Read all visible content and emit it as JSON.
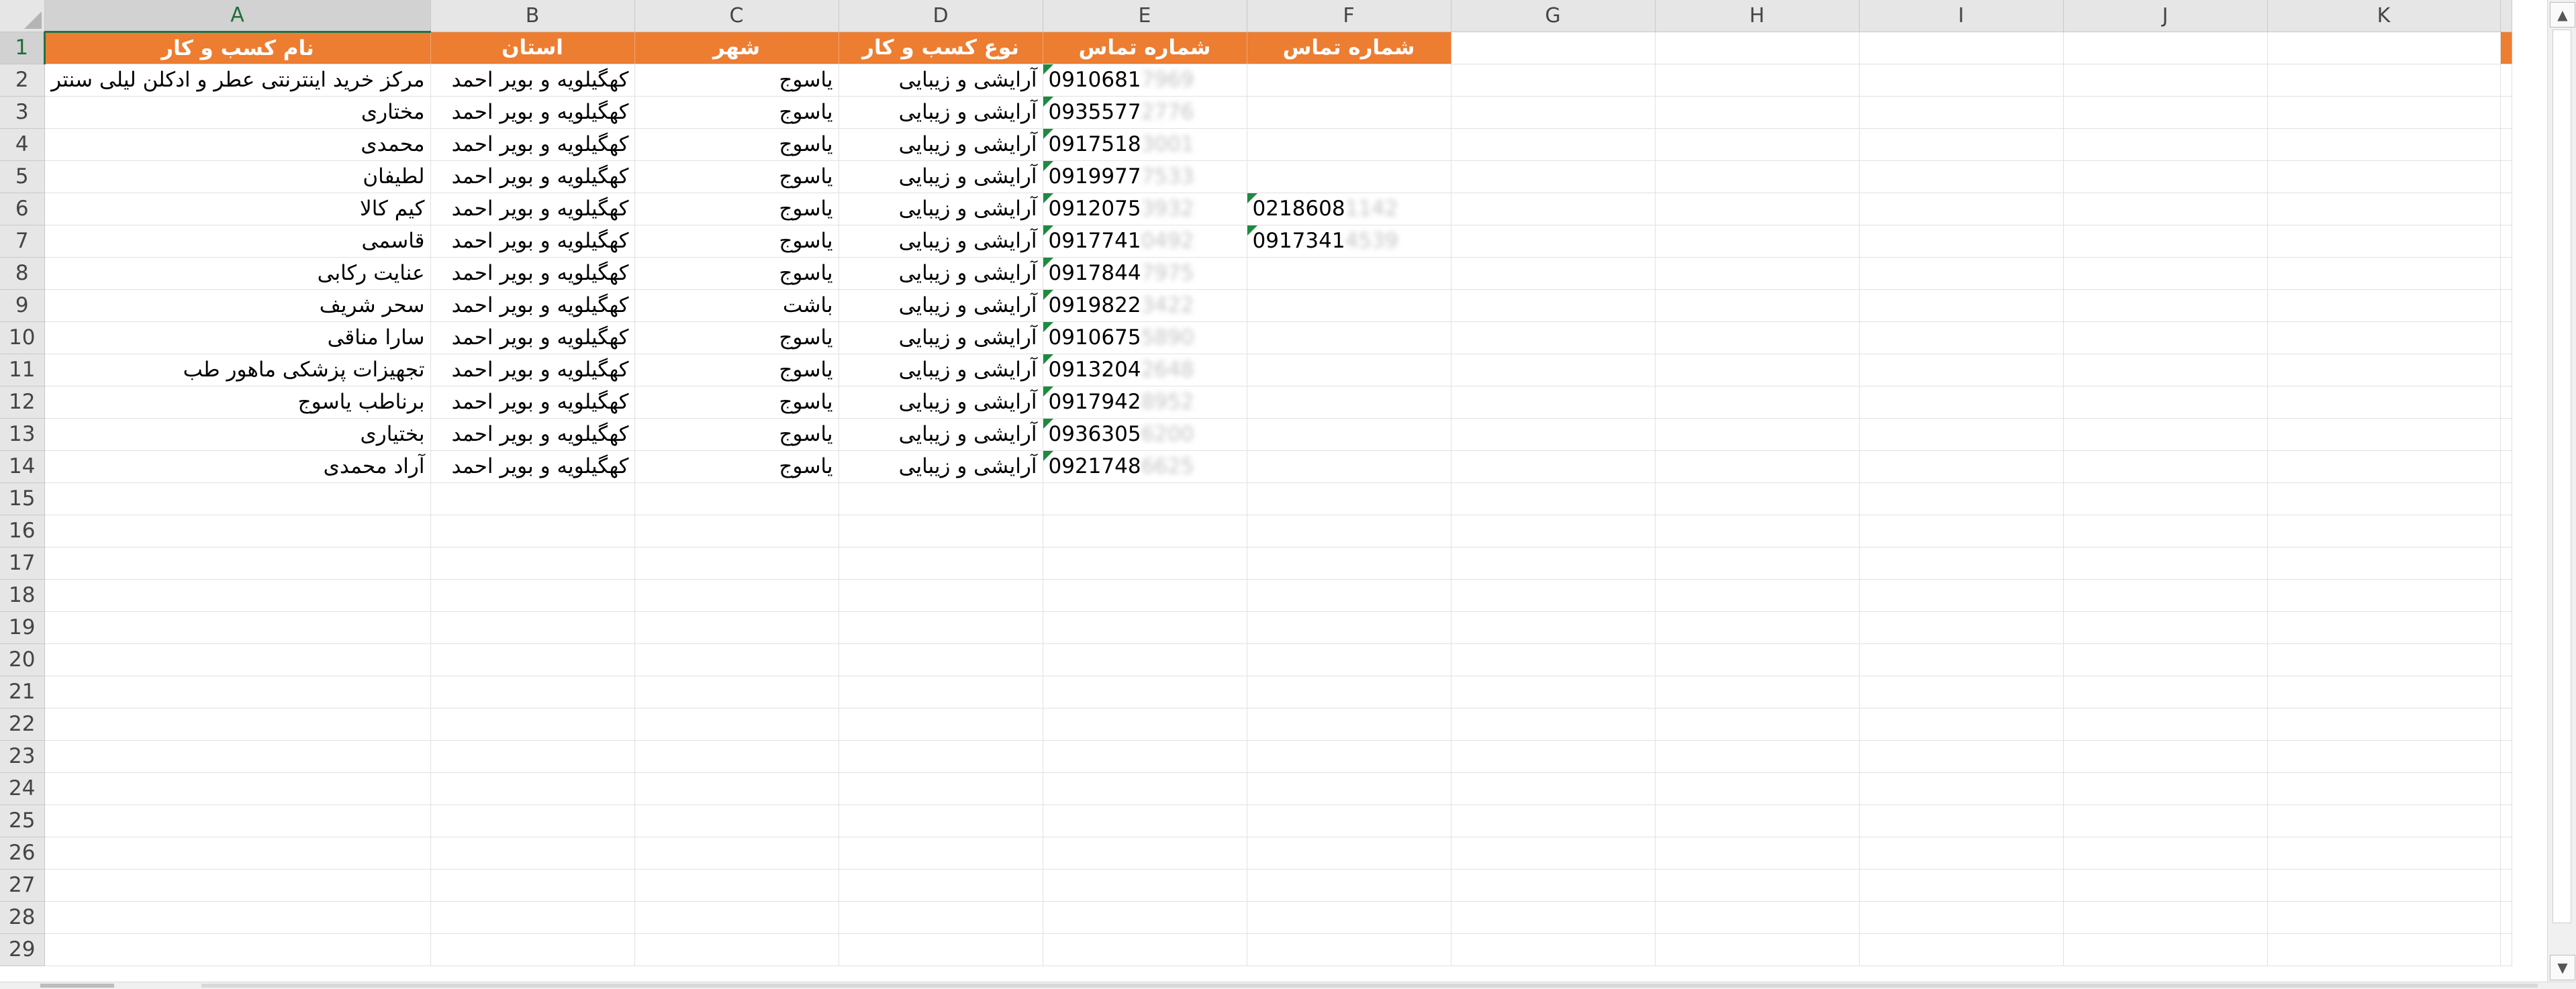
{
  "columns": [
    "A",
    "B",
    "C",
    "D",
    "E",
    "F",
    "G",
    "H",
    "I",
    "J",
    "K"
  ],
  "header_row": [
    "نام کسب و کار",
    "استان",
    "شهر",
    "نوع کسب و کار",
    "شماره تماس",
    "شماره تماس"
  ],
  "rows": [
    {
      "name": "مرکز خرید اینترنتی عطر و ادکلن لیلی سنتر",
      "province": "کهگیلویه و بویر احمد",
      "city": "یاسوج",
      "type": "آرایشی و زیبایی",
      "phone": "0910681",
      "phone_hidden": "7969",
      "phone2": "",
      "phone2_hidden": ""
    },
    {
      "name": "مختاری",
      "province": "کهگیلویه و بویر احمد",
      "city": "یاسوج",
      "type": "آرایشی و زیبایی",
      "phone": "0935577",
      "phone_hidden": "2776",
      "phone2": "",
      "phone2_hidden": ""
    },
    {
      "name": "محمدی",
      "province": "کهگیلویه و بویر احمد",
      "city": "یاسوج",
      "type": "آرایشی و زیبایی",
      "phone": "0917518",
      "phone_hidden": "3001",
      "phone2": "",
      "phone2_hidden": ""
    },
    {
      "name": "لطیفان",
      "province": "کهگیلویه و بویر احمد",
      "city": "یاسوج",
      "type": "آرایشی و زیبایی",
      "phone": "0919977",
      "phone_hidden": "7533",
      "phone2": "",
      "phone2_hidden": ""
    },
    {
      "name": "کیم کالا",
      "province": "کهگیلویه و بویر احمد",
      "city": "یاسوج",
      "type": "آرایشی و زیبایی",
      "phone": "0912075",
      "phone_hidden": "3932",
      "phone2": "0218608",
      "phone2_hidden": "1142"
    },
    {
      "name": "قاسمی",
      "province": "کهگیلویه و بویر احمد",
      "city": "یاسوج",
      "type": "آرایشی و زیبایی",
      "phone": "0917741",
      "phone_hidden": "0492",
      "phone2": "0917341",
      "phone2_hidden": "4539"
    },
    {
      "name": "عنایت رکابی",
      "province": "کهگیلویه و بویر احمد",
      "city": "یاسوج",
      "type": "آرایشی و زیبایی",
      "phone": "0917844",
      "phone_hidden": "7975",
      "phone2": "",
      "phone2_hidden": ""
    },
    {
      "name": "سحر شریف",
      "province": "کهگیلویه و بویر احمد",
      "city": "باشت",
      "type": "آرایشی و زیبایی",
      "phone": "0919822",
      "phone_hidden": "3422",
      "phone2": "",
      "phone2_hidden": ""
    },
    {
      "name": "سارا مناقی",
      "province": "کهگیلویه و بویر احمد",
      "city": "یاسوج",
      "type": "آرایشی و زیبایی",
      "phone": "0910675",
      "phone_hidden": "5890",
      "phone2": "",
      "phone2_hidden": ""
    },
    {
      "name": "تجهیزات پزشکی ماهور طب",
      "province": "کهگیلویه و بویر احمد",
      "city": "یاسوج",
      "type": "آرایشی و زیبایی",
      "phone": "0913204",
      "phone_hidden": "2648",
      "phone2": "",
      "phone2_hidden": ""
    },
    {
      "name": "برناطب یاسوج",
      "province": "کهگیلویه و بویر احمد",
      "city": "یاسوج",
      "type": "آرایشی و زیبایی",
      "phone": "0917942",
      "phone_hidden": "8952",
      "phone2": "",
      "phone2_hidden": ""
    },
    {
      "name": "بختیاری",
      "province": "کهگیلویه و بویر احمد",
      "city": "یاسوج",
      "type": "آرایشی و زیبایی",
      "phone": "0936305",
      "phone_hidden": "6200",
      "phone2": "",
      "phone2_hidden": ""
    },
    {
      "name": "آراد محمدی",
      "province": "کهگیلویه و بویر احمد",
      "city": "یاسوج",
      "type": "آرایشی و زیبایی",
      "phone": "0921748",
      "phone_hidden": "6625",
      "phone2": "",
      "phone2_hidden": ""
    }
  ],
  "row_numbers": [
    "1",
    "2",
    "3",
    "4",
    "5",
    "6",
    "7",
    "8",
    "9",
    "10",
    "11",
    "12",
    "13",
    "14",
    "15",
    "16",
    "17",
    "18",
    "19",
    "20",
    "21",
    "22",
    "23",
    "24",
    "25",
    "26",
    "27",
    "28",
    "29"
  ],
  "selected_column": "A",
  "selected_row": "1",
  "colors": {
    "header_fill": "#ed7d31",
    "header_text": "#ffffff",
    "selection": "#217346",
    "comment_flag": "#1f8a3e"
  },
  "icons": {
    "scroll_up": "scroll-up-arrow-icon",
    "scroll_down": "scroll-down-arrow-icon",
    "select_all": "select-all-triangle-icon"
  }
}
